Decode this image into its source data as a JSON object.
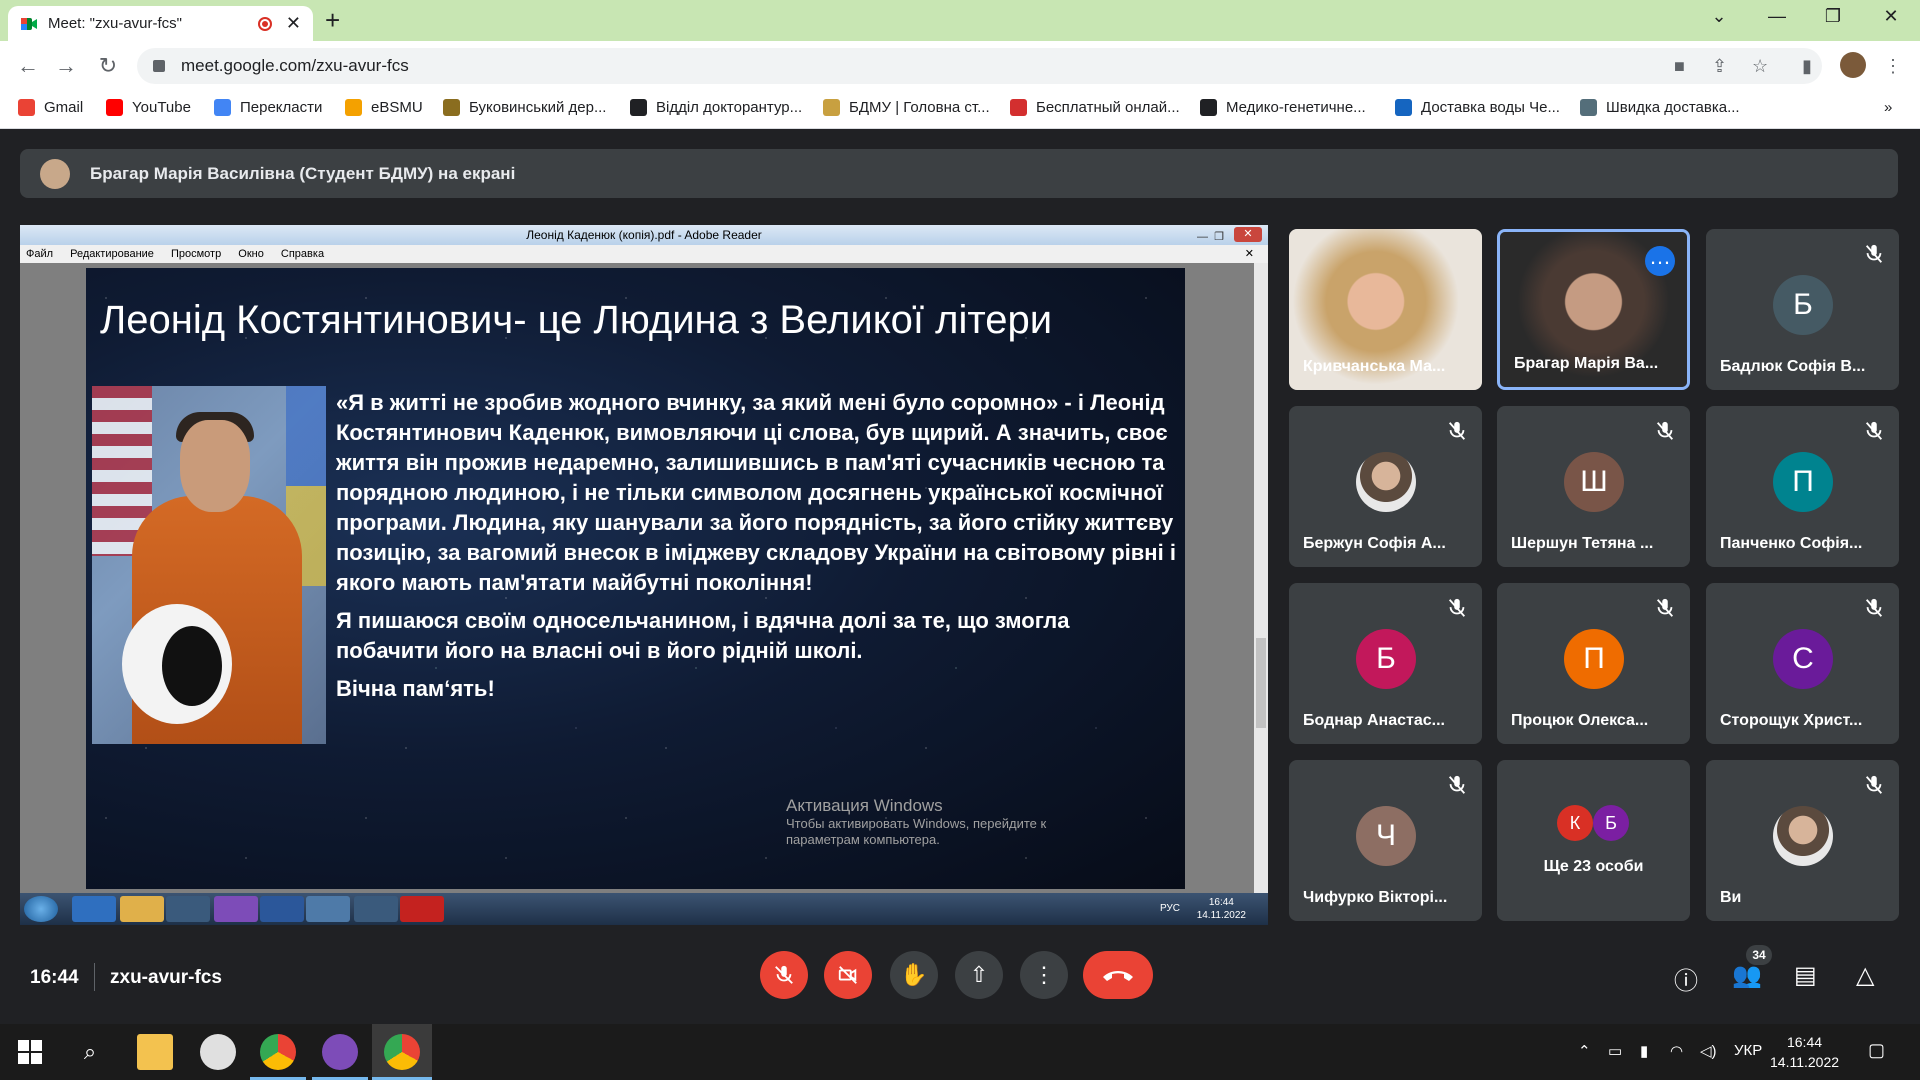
{
  "browser": {
    "tab_title": "Meet: \"zxu-avur-fcs\"",
    "url": "meet.google.com/zxu-avur-fcs"
  },
  "bookmarks": [
    {
      "label": "Gmail",
      "icon": "gmail-icon",
      "color": "#ea4335"
    },
    {
      "label": "YouTube",
      "icon": "youtube-icon",
      "color": "#ff0000"
    },
    {
      "label": "Перекласти",
      "icon": "translate-icon",
      "color": "#4285f4"
    },
    {
      "label": "eBSMU",
      "icon": "ebsmu-icon",
      "color": "#f4a100"
    },
    {
      "label": "Буковинський дер...",
      "icon": "bukovyna-icon",
      "color": "#8a6d1f"
    },
    {
      "label": "Відділ докторантур...",
      "icon": "globe-icon",
      "color": "#202124"
    },
    {
      "label": "БДМУ | Головна ст...",
      "icon": "bdmu-icon",
      "color": "#c8a040"
    },
    {
      "label": "Бесплатный онлай...",
      "icon": "grid-icon",
      "color": "#d32f2f"
    },
    {
      "label": "Медико-генетичне...",
      "icon": "globe-icon",
      "color": "#202124"
    },
    {
      "label": "Доставка воды Че...",
      "icon": "water-drop-icon",
      "color": "#1565c0"
    },
    {
      "label": "Швидка доставка...",
      "icon": "delivery-icon",
      "color": "#546e7a"
    }
  ],
  "meet": {
    "presenter_banner": "Брагар Марія Василівна (Студент БДМУ) на екрані",
    "time": "16:44",
    "meeting_code": "zxu-avur-fcs",
    "participant_count": "34",
    "accent_red": "#ea4335",
    "accent_blue": "#8ab4f8"
  },
  "shared_screen": {
    "window_title": "Леонід Каденюк (копія).pdf - Adobe Reader",
    "menu": [
      "Файл",
      "Редактирование",
      "Просмотр",
      "Окно",
      "Справка"
    ],
    "slide_title": "Леонід Костянтинович- це Людина з Великої літери",
    "paragraphs": [
      "«Я в житті не зробив жодного вчинку, за який мені було соромно» - і Леонід Костянтинович Каденюк, вимовляючи ці слова, був щирий. А значить, своє життя він прожив недаремно, залишившись в пам'яті сучасників чесною та порядною людиною, і не тільки символом досягнень української космічної програми.   Людина, яку шанували за його порядність, за його стійку життєву позицію, за вагомий внесок в іміджеву складову України на світовому рівні і якого мають пам'ятати  майбутні покоління!",
      "Я пишаюся своїм односельчанином, і вдячна долі за те, що змогла побачити його на власні очі в його рідній школі.",
      "Вічна пам‘ять!"
    ],
    "activation_title": "Активация Windows",
    "activation_sub1": "Чтобы активировать Windows, перейдите к",
    "activation_sub2": "параметрам компьютера.",
    "taskbar_lang": "РУС",
    "taskbar_time": "16:44",
    "taskbar_date": "14.11.2022"
  },
  "tiles": [
    {
      "name": "Кривчанська Ма...",
      "type": "video",
      "muted": false
    },
    {
      "name": "Брагар Марія Ва...",
      "type": "video",
      "muted": false,
      "active": true
    },
    {
      "name": "Бадлюк Софія В...",
      "type": "letter",
      "letter": "Б",
      "color": "#455a64",
      "muted": true
    },
    {
      "name": "Бержун Софія А...",
      "type": "photo",
      "muted": true
    },
    {
      "name": "Шершун Тетяна ...",
      "type": "letter",
      "letter": "Ш",
      "color": "#795548",
      "muted": true
    },
    {
      "name": "Панченко Софія...",
      "type": "letter",
      "letter": "П",
      "color": "#00838f",
      "muted": true
    },
    {
      "name": "Боднар Анастас...",
      "type": "letter",
      "letter": "Б",
      "color": "#c2185b",
      "muted": true
    },
    {
      "name": "Процюк Олекса...",
      "type": "letter",
      "letter": "П",
      "color": "#ef6c00",
      "muted": true
    },
    {
      "name": "Сторощук Христ...",
      "type": "letter",
      "letter": "С",
      "color": "#6a1b9a",
      "muted": true
    },
    {
      "name": "Чифурко Вікторі...",
      "type": "letter",
      "letter": "Ч",
      "color": "#8d6e63",
      "muted": true
    },
    {
      "name": "Ще 23 особи",
      "type": "more",
      "letters": [
        "К",
        "Б"
      ],
      "colors": [
        "#d93025",
        "#7b1fa2"
      ],
      "muted": false
    },
    {
      "name": "Ви",
      "type": "photo",
      "muted": true
    }
  ],
  "taskbar": {
    "lang": "УКР",
    "time": "16:44",
    "date": "14.11.2022"
  }
}
